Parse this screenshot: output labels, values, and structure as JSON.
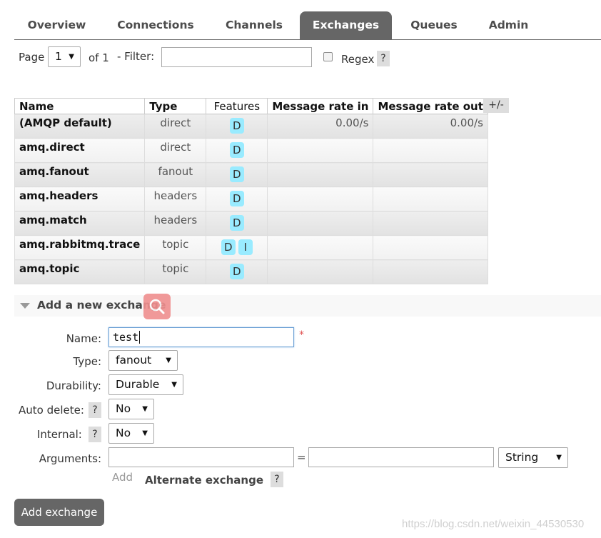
{
  "tabs": [
    {
      "label": "Overview"
    },
    {
      "label": "Connections"
    },
    {
      "label": "Channels"
    },
    {
      "label": "Exchanges",
      "active": true
    },
    {
      "label": "Queues"
    },
    {
      "label": "Admin"
    }
  ],
  "filter": {
    "page_label": "Page",
    "page_value": "1",
    "of_label": "of 1",
    "filter_label": "- Filter:",
    "filter_value": "",
    "regex_label": "Regex",
    "help": "?"
  },
  "table": {
    "columns": [
      "Name",
      "Type",
      "Features",
      "Message rate in",
      "Message rate out"
    ],
    "toggle_label": "+/-",
    "rows": [
      {
        "name": "(AMQP default)",
        "type": "direct",
        "features": [
          "D"
        ],
        "rate_in": "0.00/s",
        "rate_out": "0.00/s"
      },
      {
        "name": "amq.direct",
        "type": "direct",
        "features": [
          "D"
        ],
        "rate_in": "",
        "rate_out": ""
      },
      {
        "name": "amq.fanout",
        "type": "fanout",
        "features": [
          "D"
        ],
        "rate_in": "",
        "rate_out": ""
      },
      {
        "name": "amq.headers",
        "type": "headers",
        "features": [
          "D"
        ],
        "rate_in": "",
        "rate_out": ""
      },
      {
        "name": "amq.match",
        "type": "headers",
        "features": [
          "D"
        ],
        "rate_in": "",
        "rate_out": ""
      },
      {
        "name": "amq.rabbitmq.trace",
        "type": "topic",
        "features": [
          "D",
          "I"
        ],
        "rate_in": "",
        "rate_out": ""
      },
      {
        "name": "amq.topic",
        "type": "topic",
        "features": [
          "D"
        ],
        "rate_in": "",
        "rate_out": ""
      }
    ]
  },
  "add_section": {
    "title": "Add a new exchange",
    "name_label": "Name:",
    "name_value": "test",
    "required_mark": "*",
    "type_label": "Type:",
    "type_value": "fanout",
    "durability_label": "Durability:",
    "durability_value": "Durable",
    "auto_delete_label": "Auto delete:",
    "auto_delete_value": "No",
    "internal_label": "Internal:",
    "internal_value": "No",
    "arguments_label": "Arguments:",
    "equals": "=",
    "arg_type_value": "String",
    "add_link": "Add",
    "alternate_exchange": "Alternate exchange",
    "help": "?",
    "submit": "Add exchange"
  },
  "watermark": "https://blog.csdn.net/weixin_44530530",
  "colors": {
    "tab_active_bg": "#666666",
    "badge_bg": "#99ebff",
    "button_bg": "#666666"
  }
}
